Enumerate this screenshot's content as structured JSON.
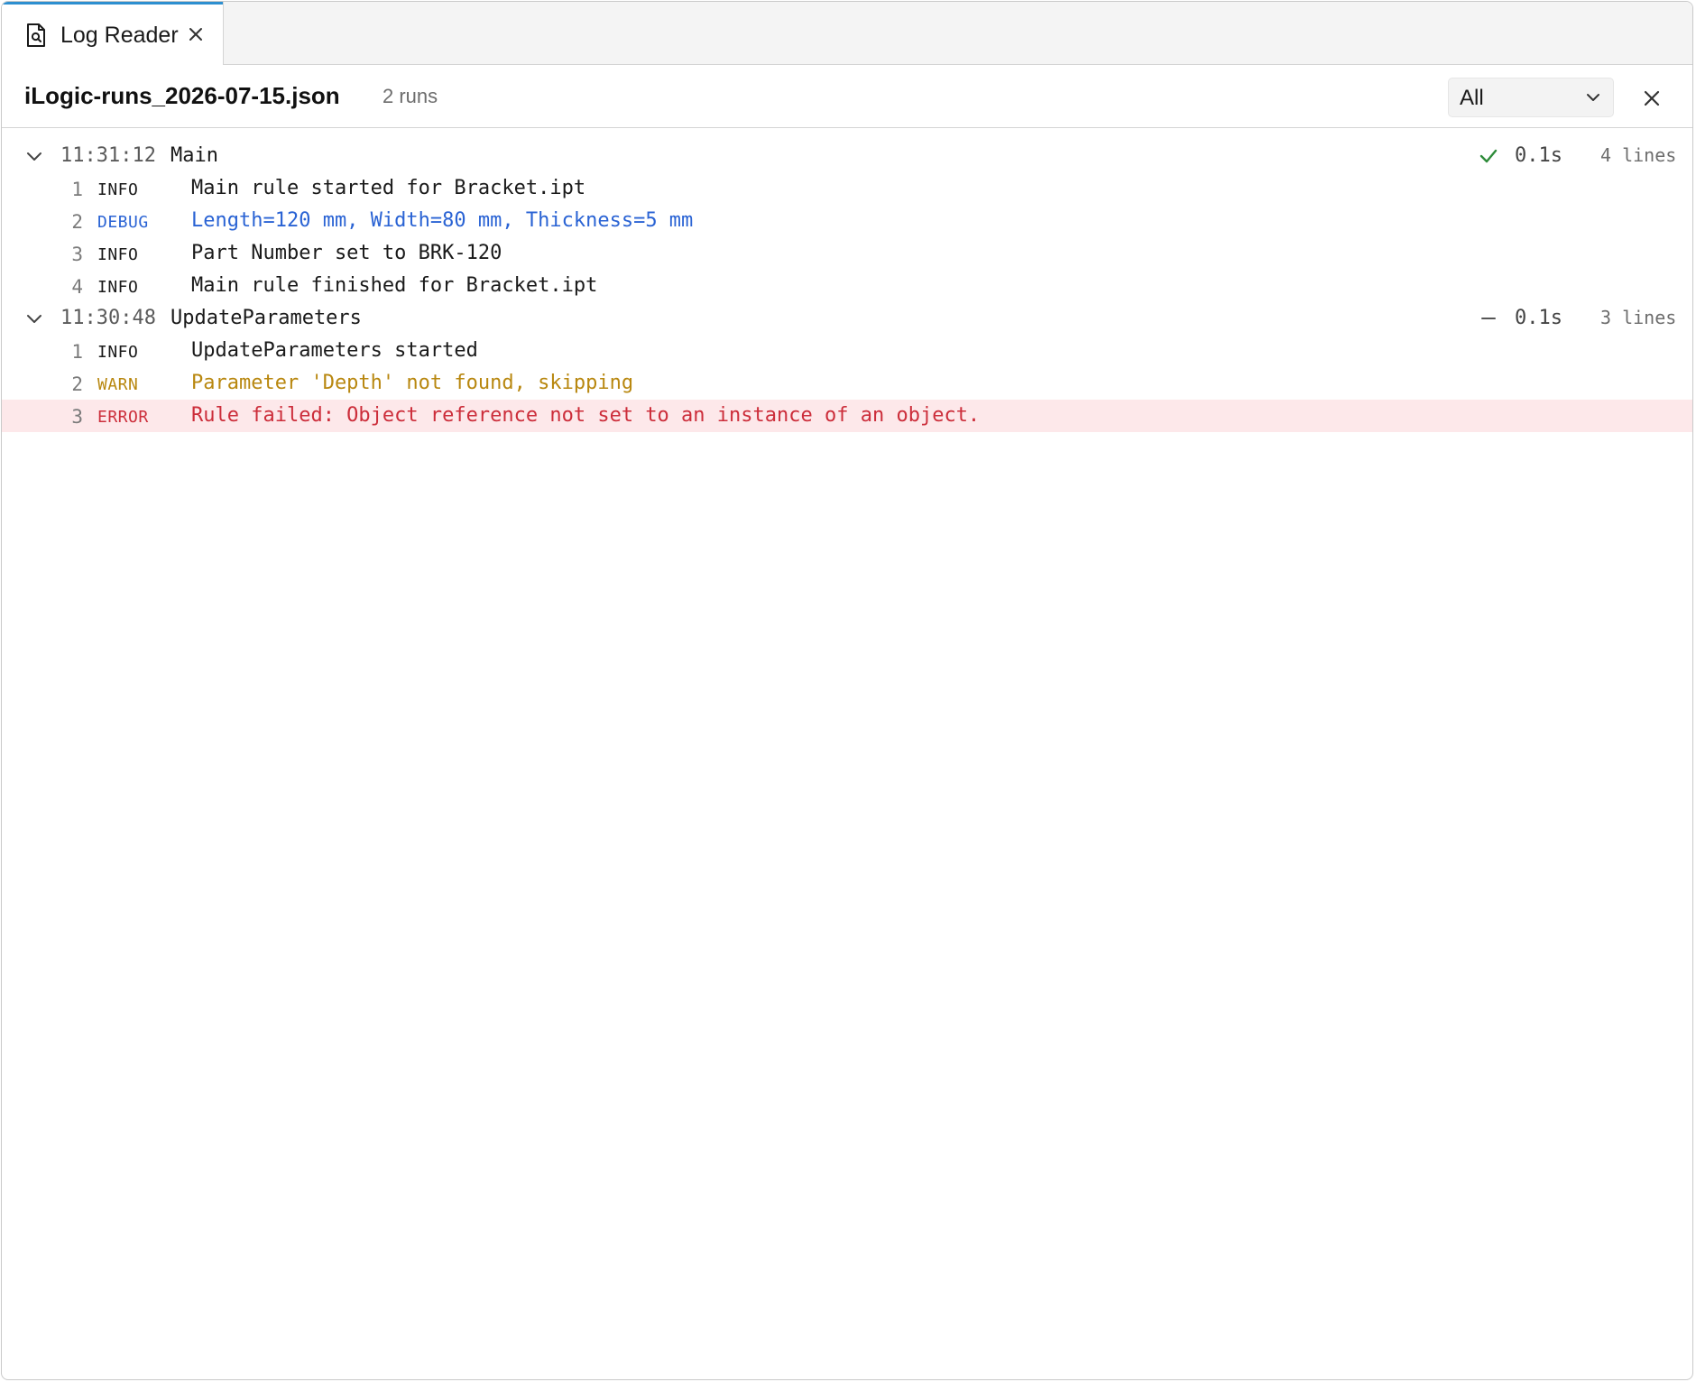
{
  "tab": {
    "label": "Log Reader",
    "icon": "file-search-icon",
    "accent_color": "#2d8fd0"
  },
  "header": {
    "file_name": "iLogic-runs_2026-07-15.json",
    "run_count": "2 runs",
    "filter": {
      "value": "All"
    }
  },
  "runs": [
    {
      "time": "11:31:12",
      "name": "Main",
      "status": "success",
      "status_icon": "check-icon",
      "duration": "0.1s",
      "line_count": "4 lines",
      "lines": [
        {
          "n": "1",
          "level": "INFO",
          "message": "Main rule started for Bracket.ipt"
        },
        {
          "n": "2",
          "level": "DEBUG",
          "message": "Length=120 mm, Width=80 mm, Thickness=5 mm"
        },
        {
          "n": "3",
          "level": "INFO",
          "message": "Part Number set to BRK-120"
        },
        {
          "n": "4",
          "level": "INFO",
          "message": "Main rule finished for Bracket.ipt"
        }
      ]
    },
    {
      "time": "11:30:48",
      "name": "UpdateParameters",
      "status": "neutral",
      "status_icon": "dash-icon",
      "duration": "0.1s",
      "line_count": "3 lines",
      "lines": [
        {
          "n": "1",
          "level": "INFO",
          "message": "UpdateParameters started"
        },
        {
          "n": "2",
          "level": "WARN",
          "message": "Parameter 'Depth' not found, skipping"
        },
        {
          "n": "3",
          "level": "ERROR",
          "message": "Rule failed: Object reference not set to an instance of an object."
        }
      ]
    }
  ],
  "colors": {
    "info": "#1a1a1a",
    "debug": "#2a63d4",
    "warn": "#b8870f",
    "error": "#cc2d3a",
    "error_row_bg": "#fde8ea",
    "success": "#2e8b3a"
  }
}
